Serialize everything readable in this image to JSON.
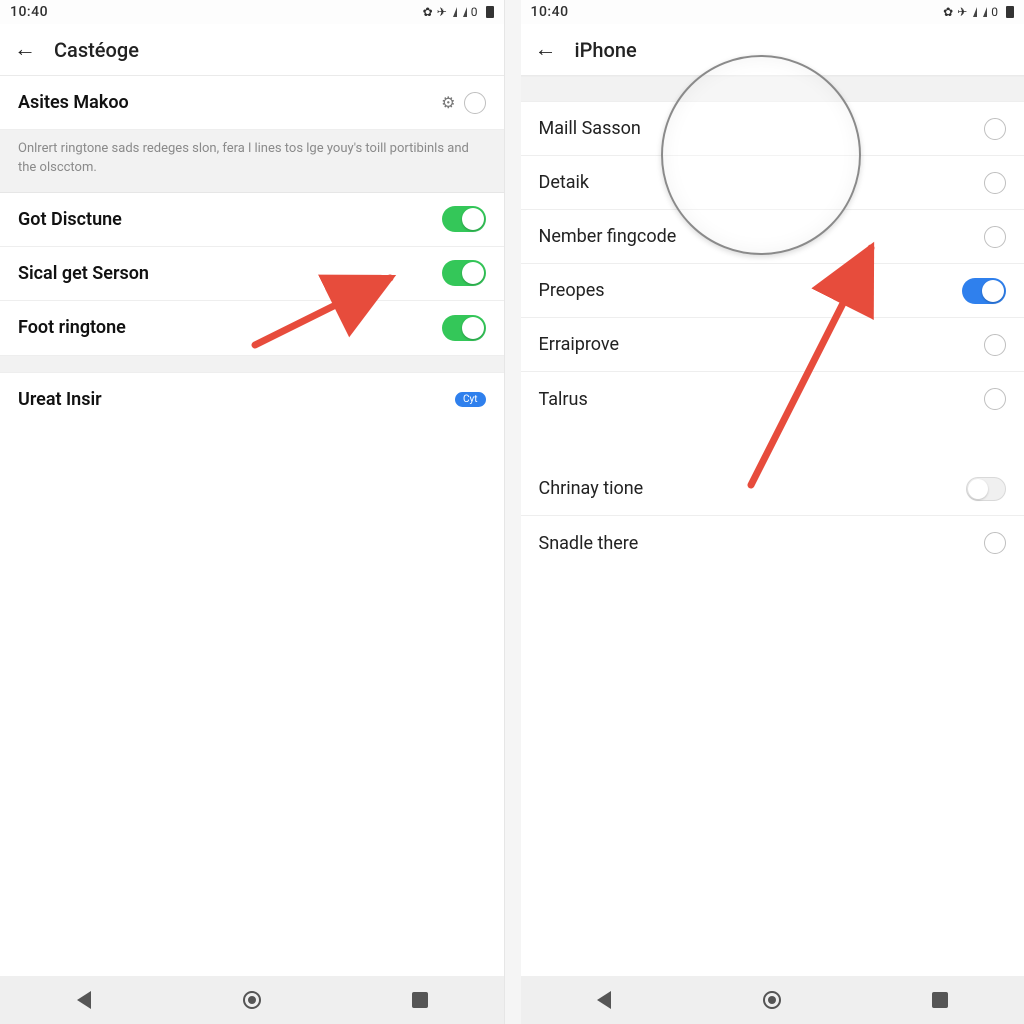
{
  "status": {
    "time": "10:40",
    "battery_text": "0"
  },
  "left": {
    "title": "Castéoge",
    "header_item": {
      "label": "Asites Makoo"
    },
    "info": "Onlrert ringtone sads redeges slon, fera l lines tos lge youy's toill portibinls and the olscctom.",
    "toggles": [
      {
        "label": "Got Disctune",
        "on": true
      },
      {
        "label": "Sical get Serson",
        "on": true
      },
      {
        "label": "Foot ringtone",
        "on": true
      }
    ],
    "footer_item": {
      "label": "Ureat Insir",
      "badge": "Cyt"
    }
  },
  "right": {
    "title": "iPhone",
    "group1": [
      {
        "label": "Maill Sasson",
        "type": "radio"
      },
      {
        "label": "Detaik",
        "type": "radio"
      },
      {
        "label": "Nember fingcode",
        "type": "radio"
      },
      {
        "label": "Preopes",
        "type": "toggle-on"
      },
      {
        "label": "Erraiprove",
        "type": "radio"
      },
      {
        "label": "Talrus",
        "type": "radio"
      }
    ],
    "group2": [
      {
        "label": "Chrinay tione",
        "type": "mini-off"
      },
      {
        "label": "Snadle there",
        "type": "radio"
      }
    ]
  }
}
